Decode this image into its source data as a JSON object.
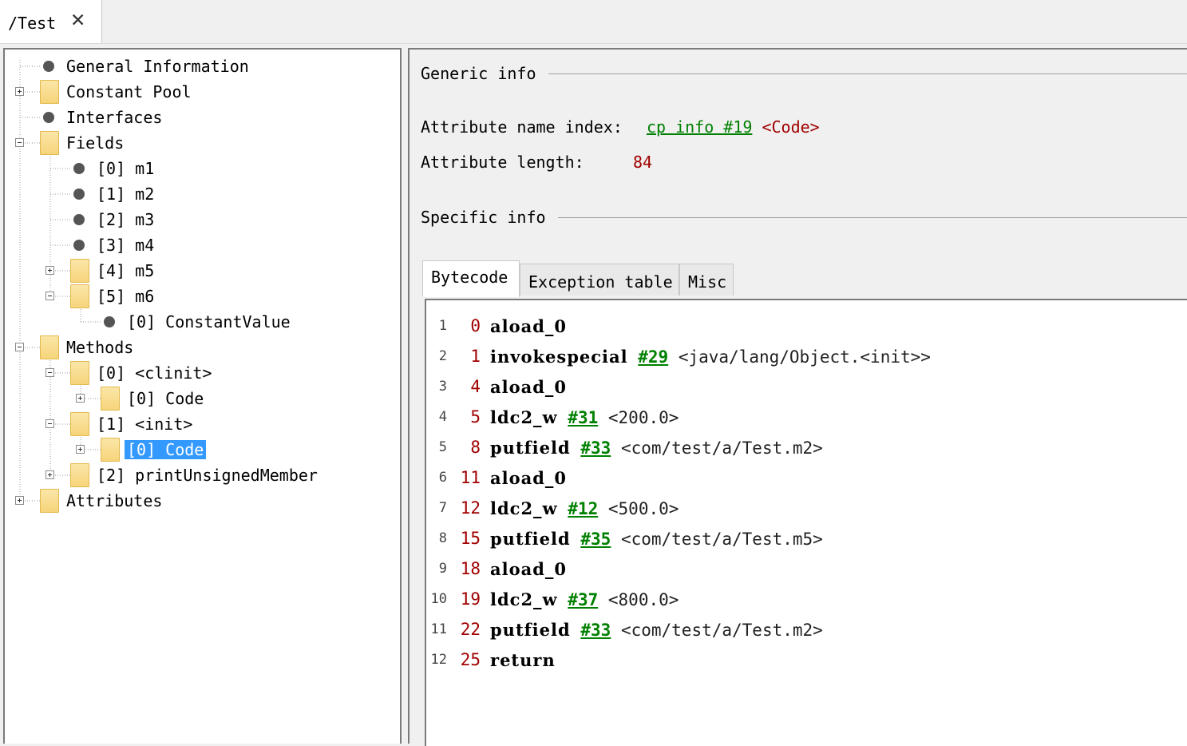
{
  "doc_tab": {
    "title": "/Test",
    "close_glyph": "✕"
  },
  "tree": [
    {
      "label": "General Information",
      "kind": "leaf"
    },
    {
      "label": "Constant Pool",
      "kind": "folder",
      "toggle": "plus"
    },
    {
      "label": "Interfaces",
      "kind": "leaf"
    },
    {
      "label": "Fields",
      "kind": "folder",
      "toggle": "minus"
    },
    {
      "label": "[0] m1",
      "kind": "leaf"
    },
    {
      "label": "[1] m2",
      "kind": "leaf"
    },
    {
      "label": "[2] m3",
      "kind": "leaf"
    },
    {
      "label": "[3] m4",
      "kind": "leaf"
    },
    {
      "label": "[4] m5",
      "kind": "folder",
      "toggle": "plus"
    },
    {
      "label": "[5] m6",
      "kind": "folder",
      "toggle": "minus"
    },
    {
      "label": "[0] ConstantValue",
      "kind": "leaf"
    },
    {
      "label": "Methods",
      "kind": "folder",
      "toggle": "minus"
    },
    {
      "label": "[0] <clinit>",
      "kind": "folder",
      "toggle": "minus"
    },
    {
      "label": "[0] Code",
      "kind": "folder",
      "toggle": "plus"
    },
    {
      "label": "[1] <init>",
      "kind": "folder",
      "toggle": "minus"
    },
    {
      "label": "[0] Code",
      "kind": "folder",
      "toggle": "plus",
      "selected": true
    },
    {
      "label": "[2] printUnsignedMember",
      "kind": "folder",
      "toggle": "plus"
    },
    {
      "label": "Attributes",
      "kind": "folder",
      "toggle": "plus"
    }
  ],
  "generic": {
    "heading": "Generic info",
    "name_index_label": "Attribute name index:",
    "name_index_link": "cp info #19",
    "name_index_value": "<Code>",
    "length_label": "Attribute length:",
    "length_value": "84"
  },
  "specific": {
    "heading": "Specific info"
  },
  "tabs": [
    "Bytecode",
    "Exception table",
    "Misc"
  ],
  "active_tab": "Bytecode",
  "bytecode": [
    {
      "line": "1",
      "offset": "0",
      "op": "aload_0",
      "ref": "",
      "comment": ""
    },
    {
      "line": "2",
      "offset": "1",
      "op": "invokespecial",
      "ref": "#29",
      "comment": "<java/lang/Object.<init>>"
    },
    {
      "line": "3",
      "offset": "4",
      "op": "aload_0",
      "ref": "",
      "comment": ""
    },
    {
      "line": "4",
      "offset": "5",
      "op": "ldc2_w",
      "ref": "#31",
      "comment": "<200.0>"
    },
    {
      "line": "5",
      "offset": "8",
      "op": "putfield",
      "ref": "#33",
      "comment": "<com/test/a/Test.m2>"
    },
    {
      "line": "6",
      "offset": "11",
      "op": "aload_0",
      "ref": "",
      "comment": ""
    },
    {
      "line": "7",
      "offset": "12",
      "op": "ldc2_w",
      "ref": "#12",
      "comment": "<500.0>"
    },
    {
      "line": "8",
      "offset": "15",
      "op": "putfield",
      "ref": "#35",
      "comment": "<com/test/a/Test.m5>"
    },
    {
      "line": "9",
      "offset": "18",
      "op": "aload_0",
      "ref": "",
      "comment": ""
    },
    {
      "line": "10",
      "offset": "19",
      "op": "ldc2_w",
      "ref": "#37",
      "comment": "<800.0>"
    },
    {
      "line": "11",
      "offset": "22",
      "op": "putfield",
      "ref": "#33",
      "comment": "<com/test/a/Test.m2>"
    },
    {
      "line": "12",
      "offset": "25",
      "op": "return",
      "ref": "",
      "comment": ""
    }
  ]
}
